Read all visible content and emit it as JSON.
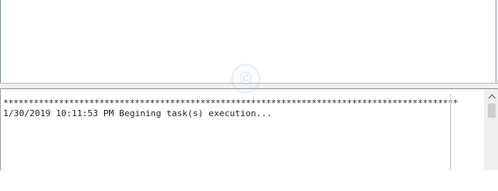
{
  "log": {
    "lines": [
      "******************************************************************************************",
      "1/30/2019 10:11:53 PM Begining task(s) execution..."
    ]
  },
  "icons": {
    "scroll_up": "triangle-up-icon",
    "watermark": "copyright-icon"
  },
  "colors": {
    "pane_border": "#6f8fb3",
    "splitter": "#f0f0f0",
    "text": "#1a1a1a",
    "scrollbar_track": "#f0f0f0",
    "scrollbar_thumb": "#cdcdcd"
  }
}
